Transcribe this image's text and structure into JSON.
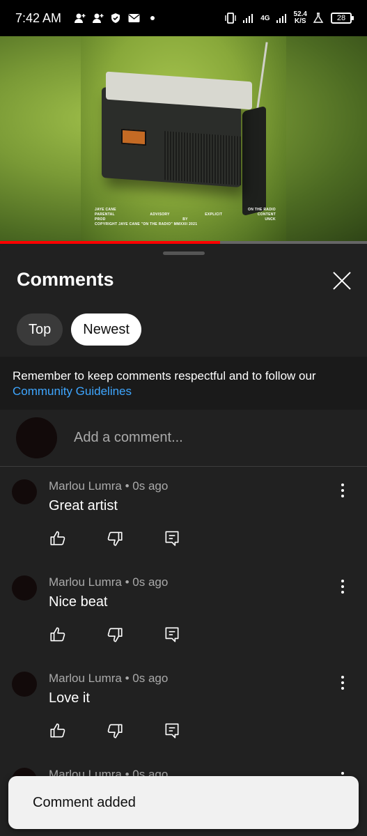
{
  "status_bar": {
    "time": "7:42 AM",
    "network": "4G",
    "speed_value": "52.4",
    "speed_unit": "K/S",
    "battery": "28"
  },
  "video": {
    "progress": 0.6,
    "cover_text": {
      "artist": "JAYE CANE",
      "album": "ON THE RADIO",
      "advisory": [
        "PARENTAL",
        "ADVISORY",
        "EXPLICIT",
        "CONTENT"
      ],
      "prod": [
        "PROD",
        "BY",
        "UNCK"
      ],
      "copyright": "COPYRIGHT JAYE CANE \"ON THE RADIO\" MMXXII 2021"
    }
  },
  "sheet": {
    "title": "Comments",
    "tabs": [
      {
        "label": "Top",
        "active": false
      },
      {
        "label": "Newest",
        "active": true
      }
    ],
    "notice": "Remember to keep comments respectful and to follow our",
    "guidelines_link": "Community Guidelines",
    "add_comment_placeholder": "Add a comment...",
    "comments": [
      {
        "author": "Marlou Lumra",
        "age": "0s ago",
        "text": "Great artist"
      },
      {
        "author": "Marlou Lumra",
        "age": "0s ago",
        "text": "Nice beat"
      },
      {
        "author": "Marlou Lumra",
        "age": "0s ago",
        "text": "Love it"
      },
      {
        "author": "Marlou Lumra",
        "age": "0s ago",
        "text": ""
      }
    ]
  },
  "snackbar": {
    "text": "Comment added"
  },
  "colors": {
    "accent_link": "#3ea6ff",
    "progress": "#ff0000",
    "background": "#212121"
  }
}
